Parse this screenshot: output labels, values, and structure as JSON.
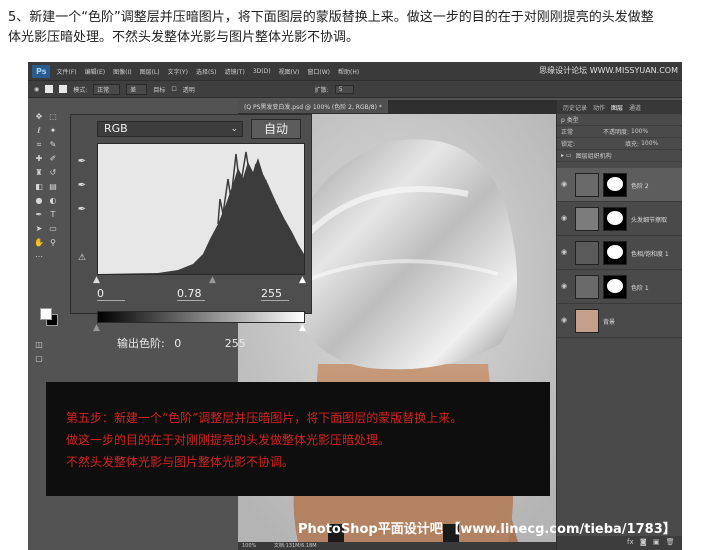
{
  "caption": {
    "line1": "5、新建一个“色阶”调整层并压暗图片，将下面图层的蒙版替换上来。做这一步的目的在于对刚刚提亮的头发做整",
    "line2": "体光影压暗处理。不然头发整体光影与图片整体光影不协调。"
  },
  "menubar": {
    "logo": "Ps",
    "items": [
      "文件(F)",
      "编辑(E)",
      "图像(I)",
      "图层(L)",
      "文字(Y)",
      "选择(S)",
      "滤镜(T)",
      "3D(D)",
      "视图(V)",
      "窗口(W)",
      "帮助(H)"
    ],
    "watermark": "思缘设计论坛 WWW.MISSYUAN.COM"
  },
  "optionsbar": {
    "mode_label": "模式:",
    "mode_value": "正常",
    "mode2": "差",
    "item2": "目标",
    "checkbox_label": "透明",
    "extra": "扩散:",
    "extra_value": "5"
  },
  "document_tab": {
    "title": "(Q PS黑发变白发.psd @ 100% (色阶 2, RGB/8) *"
  },
  "status": {
    "zoom": "100%",
    "doc": "文档:131M/6.18M"
  },
  "levels": {
    "channel": "RGB",
    "auto_label": "自动",
    "input_black": "0",
    "input_mid": "0.78",
    "input_white": "255",
    "output_label": "输出色阶:",
    "output_black": "0",
    "output_white": "255"
  },
  "panel_right": {
    "tabs": [
      "历史记录",
      "动作",
      "图层",
      "通道"
    ],
    "kind_label": "p 类型",
    "blend_mode": "正常",
    "opacity_label": "不透明度:",
    "opacity_value": "100%",
    "lock_label": "锁定:",
    "fill_label": "填充:",
    "fill_value": "100%",
    "group_name": "图层组织机构",
    "layers": [
      {
        "name": "色阶 2",
        "type": "levels",
        "selected": true
      },
      {
        "name": "头发细节擦取",
        "type": "pixel",
        "selected": false
      },
      {
        "name": "色相/饱和度 1",
        "type": "hue",
        "selected": false
      },
      {
        "name": "色阶 1",
        "type": "levels",
        "selected": false
      },
      {
        "name": "背景",
        "type": "photo",
        "selected": false
      }
    ],
    "footer_icons": "fx"
  },
  "overlay": {
    "line1": "第五步：新建一个“色阶”调整层并压暗图片，将下面图层的蒙版替换上来。",
    "line2": "做这一步的目的在于对刚刚提亮的头发做整体光影压暗处理。",
    "line3": "不然头发整体光影与图片整体光影不协调。"
  },
  "watermark_bottom": "PhotoShop平面设计吧 【www.linecg.com/tieba/1783】",
  "colors": {
    "ps_bg": "#535353",
    "overlay_bg": "#0e0e0e",
    "overlay_text": "#d42222",
    "histogram_bg": "#e7e7e7"
  }
}
